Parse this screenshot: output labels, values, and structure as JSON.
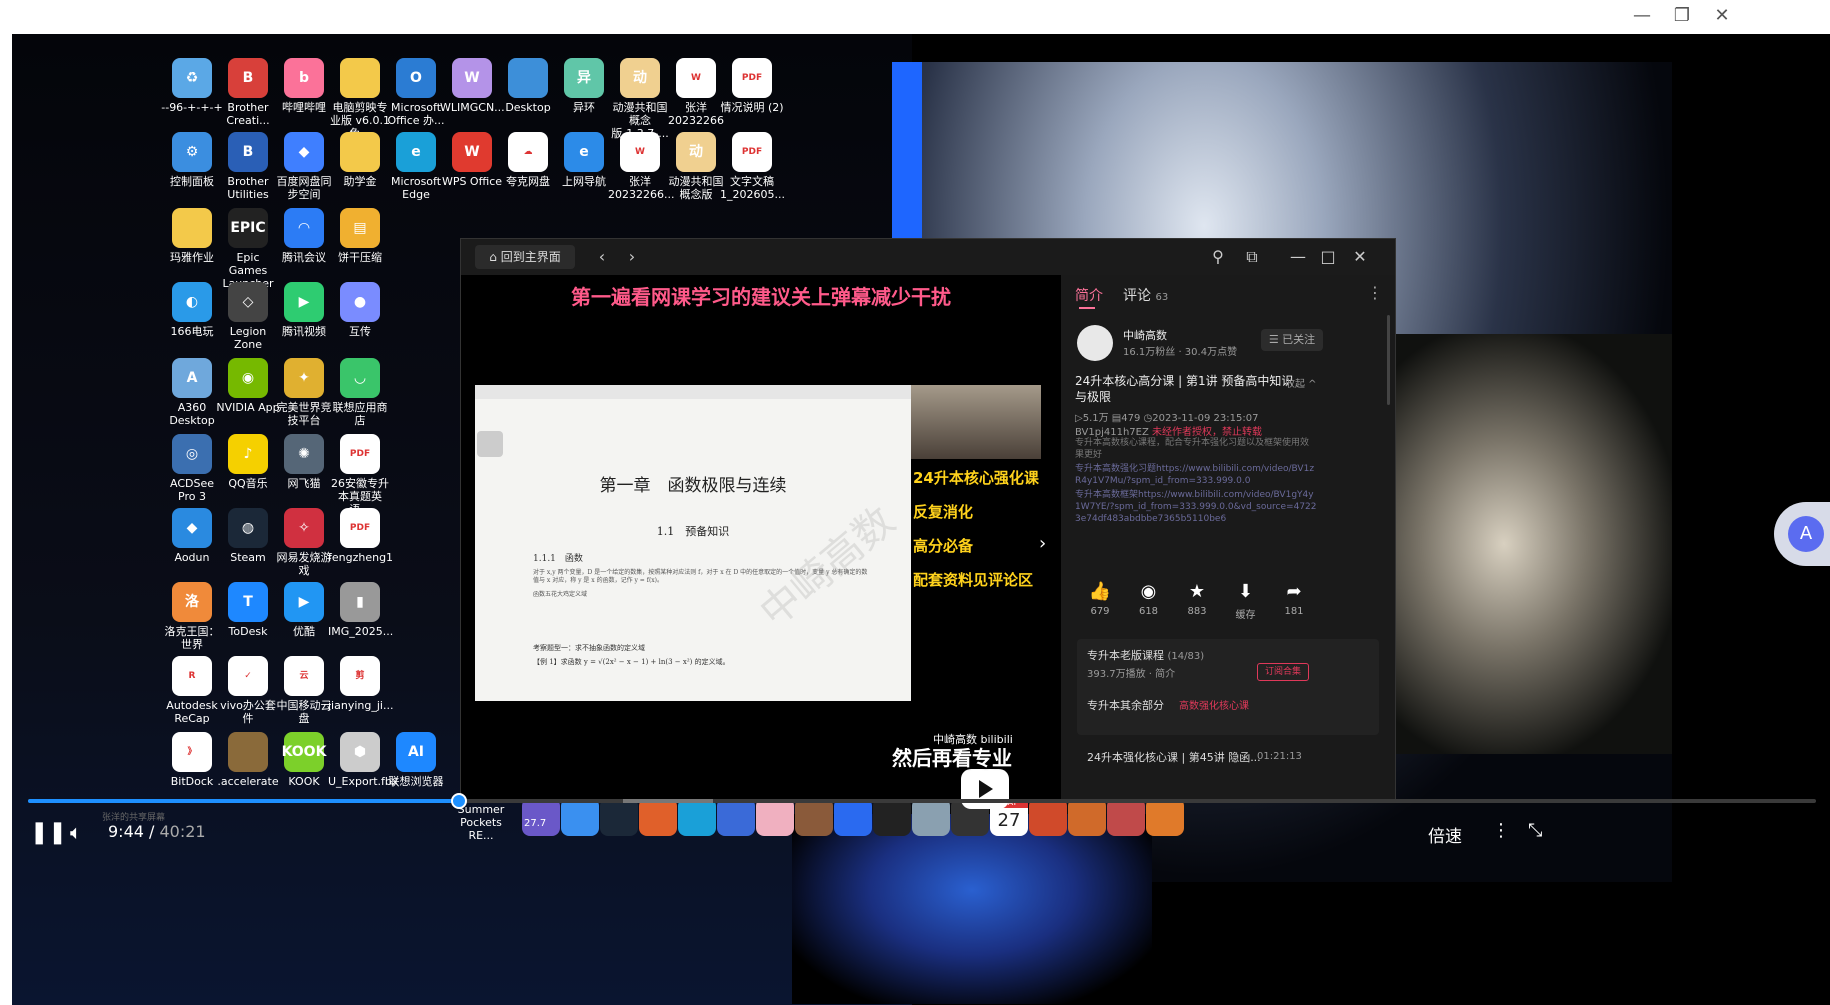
{
  "window": {
    "controls": {
      "minimize": "—",
      "restore": "❐",
      "close": "✕"
    }
  },
  "desktop_icons": [
    {
      "label": "--96-+-+-+",
      "icon": "recycle-bin-icon",
      "color": "#5ba8e6",
      "glyph": "♻"
    },
    {
      "label": "Brother Creati...",
      "icon": "brother-icon",
      "color": "#d8403a",
      "glyph": "B"
    },
    {
      "label": "哔哩哔哩",
      "icon": "bilibili-icon",
      "color": "#fb7299",
      "glyph": "b"
    },
    {
      "label": "电脑剪映专业版 v6.0.1 免...",
      "icon": "folder-icon",
      "color": "#f3c94a",
      "glyph": ""
    },
    {
      "label": "Microsoft Office 办...",
      "icon": "office-icon",
      "color": "#2b7cd3",
      "glyph": "O"
    },
    {
      "label": "WLIMGCN...",
      "icon": "wlimg-icon",
      "color": "#b493e8",
      "glyph": "W"
    },
    {
      "label": "Desktop",
      "icon": "desktop-folder-icon",
      "color": "#3d8fd9",
      "glyph": ""
    },
    {
      "label": "异环",
      "icon": "game-icon",
      "color": "#60c6a8",
      "glyph": "异"
    },
    {
      "label": "动漫共和国概念版-1.3.7-...",
      "icon": "anime-game-icon",
      "color": "#f0d090",
      "glyph": "动"
    },
    {
      "label": "张洋 20232266",
      "icon": "word-doc-icon",
      "color": "#ffffff",
      "glyph": "W"
    },
    {
      "label": "情况说明 (2)",
      "icon": "pdf-icon",
      "color": "#ffffff",
      "glyph": "PDF"
    },
    {
      "label": "控制面板",
      "icon": "control-panel-icon",
      "color": "#3b8ee0",
      "glyph": "⚙"
    },
    {
      "label": "Brother Utilities",
      "icon": "brother-utilities-icon",
      "color": "#2a5fb6",
      "glyph": "B"
    },
    {
      "label": "百度网盘同步空间",
      "icon": "baidu-sync-icon",
      "color": "#3f7fff",
      "glyph": "◆"
    },
    {
      "label": "助学金",
      "icon": "folder-icon",
      "color": "#f3c94a",
      "glyph": ""
    },
    {
      "label": "Microsoft Edge",
      "icon": "edge-icon",
      "color": "#1aa0d8",
      "glyph": "e"
    },
    {
      "label": "WPS Office",
      "icon": "wps-icon",
      "color": "#e03a2f",
      "glyph": "W"
    },
    {
      "label": "夸克网盘",
      "icon": "quark-icon",
      "color": "#ffffff",
      "glyph": "☁"
    },
    {
      "label": "上网导航",
      "icon": "ie-icon",
      "color": "#2c8be8",
      "glyph": "e"
    },
    {
      "label": "张洋 20232266...",
      "icon": "word-doc-icon",
      "color": "#ffffff",
      "glyph": "W"
    },
    {
      "label": "动漫共和国概念版",
      "icon": "anime-game-icon",
      "color": "#f0d090",
      "glyph": "动"
    },
    {
      "label": "文字文稿 1_202605...",
      "icon": "pdf-icon",
      "color": "#ffffff",
      "glyph": "PDF"
    },
    {
      "label": "玛雅作业",
      "icon": "folder-icon",
      "color": "#f3c94a",
      "glyph": ""
    },
    {
      "label": "Epic Games Launcher",
      "icon": "epic-icon",
      "color": "#222222",
      "glyph": "EPIC"
    },
    {
      "label": "腾讯会议",
      "icon": "tencent-meeting-icon",
      "color": "#2c7cf5",
      "glyph": "◠"
    },
    {
      "label": "饼干压缩",
      "icon": "zip-icon",
      "color": "#f0b030",
      "glyph": "▤"
    },
    {
      "label": "166电玩",
      "icon": "game166-icon",
      "color": "#2a9ae8",
      "glyph": "◐"
    },
    {
      "label": "Legion Zone",
      "icon": "legion-icon",
      "color": "#444444",
      "glyph": "◇"
    },
    {
      "label": "腾讯视频",
      "icon": "tencent-video-icon",
      "color": "#2ecc71",
      "glyph": "▶"
    },
    {
      "label": "互传",
      "icon": "hutransfer-icon",
      "color": "#7a8cff",
      "glyph": "●"
    },
    {
      "label": "A360 Desktop",
      "icon": "a360-icon",
      "color": "#6fa8dc",
      "glyph": "A"
    },
    {
      "label": "NVIDIA App",
      "icon": "nvidia-icon",
      "color": "#76b900",
      "glyph": "◉"
    },
    {
      "label": "完美世界竞技平台",
      "icon": "perfect-world-icon",
      "color": "#e0b030",
      "glyph": "✦"
    },
    {
      "label": "联想应用商店",
      "icon": "lenovo-store-icon",
      "color": "#3ac56a",
      "glyph": "◡"
    },
    {
      "label": "ACDSee Pro 3",
      "icon": "acdsee-icon",
      "color": "#3b6fb0",
      "glyph": "◎"
    },
    {
      "label": "QQ音乐",
      "icon": "qqmusic-icon",
      "color": "#f5d000",
      "glyph": "♪"
    },
    {
      "label": "网飞猫",
      "icon": "netcat-icon",
      "color": "#556677",
      "glyph": "✺"
    },
    {
      "label": "26安徽专升本真题英语...",
      "icon": "pdf-icon",
      "color": "#ffffff",
      "glyph": "PDF"
    },
    {
      "label": "Aodun",
      "icon": "aodun-icon",
      "color": "#2a8ae0",
      "glyph": "◆"
    },
    {
      "label": "Steam",
      "icon": "steam-icon",
      "color": "#1b2838",
      "glyph": "◍"
    },
    {
      "label": "网易发烧游戏",
      "icon": "netease-game-icon",
      "color": "#d03040",
      "glyph": "✧"
    },
    {
      "label": "fengzheng1",
      "icon": "pdf-icon",
      "color": "#ffffff",
      "glyph": "PDF"
    },
    {
      "label": "洛克王国：世界",
      "icon": "roco-icon",
      "color": "#f08a3a",
      "glyph": "洛"
    },
    {
      "label": "ToDesk",
      "icon": "todesk-icon",
      "color": "#1e88ff",
      "glyph": "T"
    },
    {
      "label": "优酷",
      "icon": "youku-icon",
      "color": "#2196f3",
      "glyph": "▶"
    },
    {
      "label": "IMG_2025...",
      "icon": "image-file-icon",
      "color": "#999999",
      "glyph": "▮"
    },
    {
      "label": "Autodesk ReCap",
      "icon": "recap-icon",
      "color": "#ffffff",
      "glyph": "R"
    },
    {
      "label": "vivo办公套件",
      "icon": "vivo-icon",
      "color": "#ffffff",
      "glyph": "✓"
    },
    {
      "label": "中国移动云盘",
      "icon": "cmcc-cloud-icon",
      "color": "#ffffff",
      "glyph": "云"
    },
    {
      "label": "jianying_ji...",
      "icon": "jianying-icon",
      "color": "#ffffff",
      "glyph": "剪"
    },
    {
      "label": "BitDock",
      "icon": "bitdock-icon",
      "color": "#ffffff",
      "glyph": "》"
    },
    {
      "label": ".accelerate",
      "icon": "folder-dark-icon",
      "color": "#8a6a3a",
      "glyph": ""
    },
    {
      "label": "KOOK",
      "icon": "kook-icon",
      "color": "#7cd02a",
      "glyph": "KOOK"
    },
    {
      "label": "U_Export.fbx",
      "icon": "fbx-icon",
      "color": "#cccccc",
      "glyph": "⬢"
    },
    {
      "label": "联想浏览器",
      "icon": "lenovo-browser-icon",
      "color": "#1e88ff",
      "glyph": "AI"
    }
  ],
  "taskbar": {
    "summer_label": "Summer Pockets RE...",
    "temperature": "27.7",
    "calendar_month": "MAY",
    "calendar_day": "27",
    "items": [
      "cloud-weather-icon",
      "play-app-icon",
      "steam-icon",
      "game-lantern-icon",
      "edge-icon",
      "kodi-icon",
      "anime-girl-icon",
      "game-warrior-icon",
      "m-app-icon",
      "dark-app-icon",
      "landscape-app-icon",
      "percent-app-icon",
      "calendar-icon",
      "lantern-icon",
      "lantern-icon",
      "rocket-icon",
      "lantern-icon"
    ]
  },
  "bili_window": {
    "home_button": "回到主界面",
    "notice": "第一遍看网课学习的建议关上弹幕减少干扰",
    "slide": {
      "chapter": "第一章　函数极限与连续",
      "section": "1.1　预备知识",
      "subsection": "1.1.1　函数",
      "body": "对于 x,y 两个变量，D 是一个给定的数集，按照某种对应法则 f，对于 x 在 D 中的任意取定的一个值时，变量 y 总有确定的数值与 x 对应，称 y 是 x 的函数，记作 y = f(x)。",
      "body2": "函数五花大鸡定义域",
      "example_title": "考察题型一：求不抽象函数的定义域",
      "example": "【例 1】求函数 y = √(2x² − x − 1) + ln(3 − x²) 的定义域。"
    },
    "side_lines": [
      "24升本核心强化课",
      "反复消化",
      "高分必备",
      "配套资料见评论区"
    ],
    "watermark": "中崎高数",
    "bili_logo": "bilibili",
    "panel": {
      "tab_intro": "简介",
      "tab_comments": "评论",
      "comment_count": "63",
      "uploader": "中崎高数",
      "uploader_stats": "16.1万粉丝 · 30.4万点赞",
      "follow_label": "☰ 已关注",
      "title": "24升本核心高分课 | 第1讲 预备高中知识与极限",
      "collapse": "收起 ^",
      "views": "5.1万",
      "danmaku": "479",
      "date": "2023-11-09 23:15:07",
      "bvid": "BV1pj411h7EZ",
      "no_repost": "未经作者授权，禁止转载",
      "desc1": "专升本高数核心课程，配合专升本强化习题以及框架使用效果更好",
      "desc2": "专升本高数强化习题https://www.bilibili.com/video/BV1zR4y1V7Mu/?spm_id_from=333.999.0.0",
      "desc3": "专升本高数框架https://www.bilibili.com/video/BV1gY4y1W7YE/?spm_id_from=333.999.0.0&vd_source=47223e74df483abdbbe7365b5110be6",
      "stats": [
        {
          "icon": "thumb-up-icon",
          "glyph": "👍",
          "value": "679"
        },
        {
          "icon": "coin-icon",
          "glyph": "◉",
          "value": "618"
        },
        {
          "icon": "star-icon",
          "glyph": "★",
          "value": "883"
        },
        {
          "icon": "cache-icon",
          "glyph": "⬇",
          "value": "缓存"
        },
        {
          "icon": "share-icon",
          "glyph": "➦",
          "value": "181"
        }
      ],
      "series_title": "专升本老版课程",
      "series_count": "(14/83)",
      "series_meta": "393.7万播放 · 简介",
      "subscribe": "订阅合集",
      "other_label": "专升本其余部分",
      "other_link": "高数强化核心课",
      "next_item": "24升本强化核心课 | 第45讲 隐函...",
      "next_duration": "01:21:13"
    }
  },
  "player": {
    "subtitle": "然后再看专业",
    "current_time": "9:44",
    "separator": " / ",
    "total_time": "40:21",
    "progress": 0.241,
    "buffer_start": 0.333,
    "buffer_end": 0.383,
    "speed_label": "倍速",
    "screen_share_hint": "张洋的共享屏幕"
  }
}
